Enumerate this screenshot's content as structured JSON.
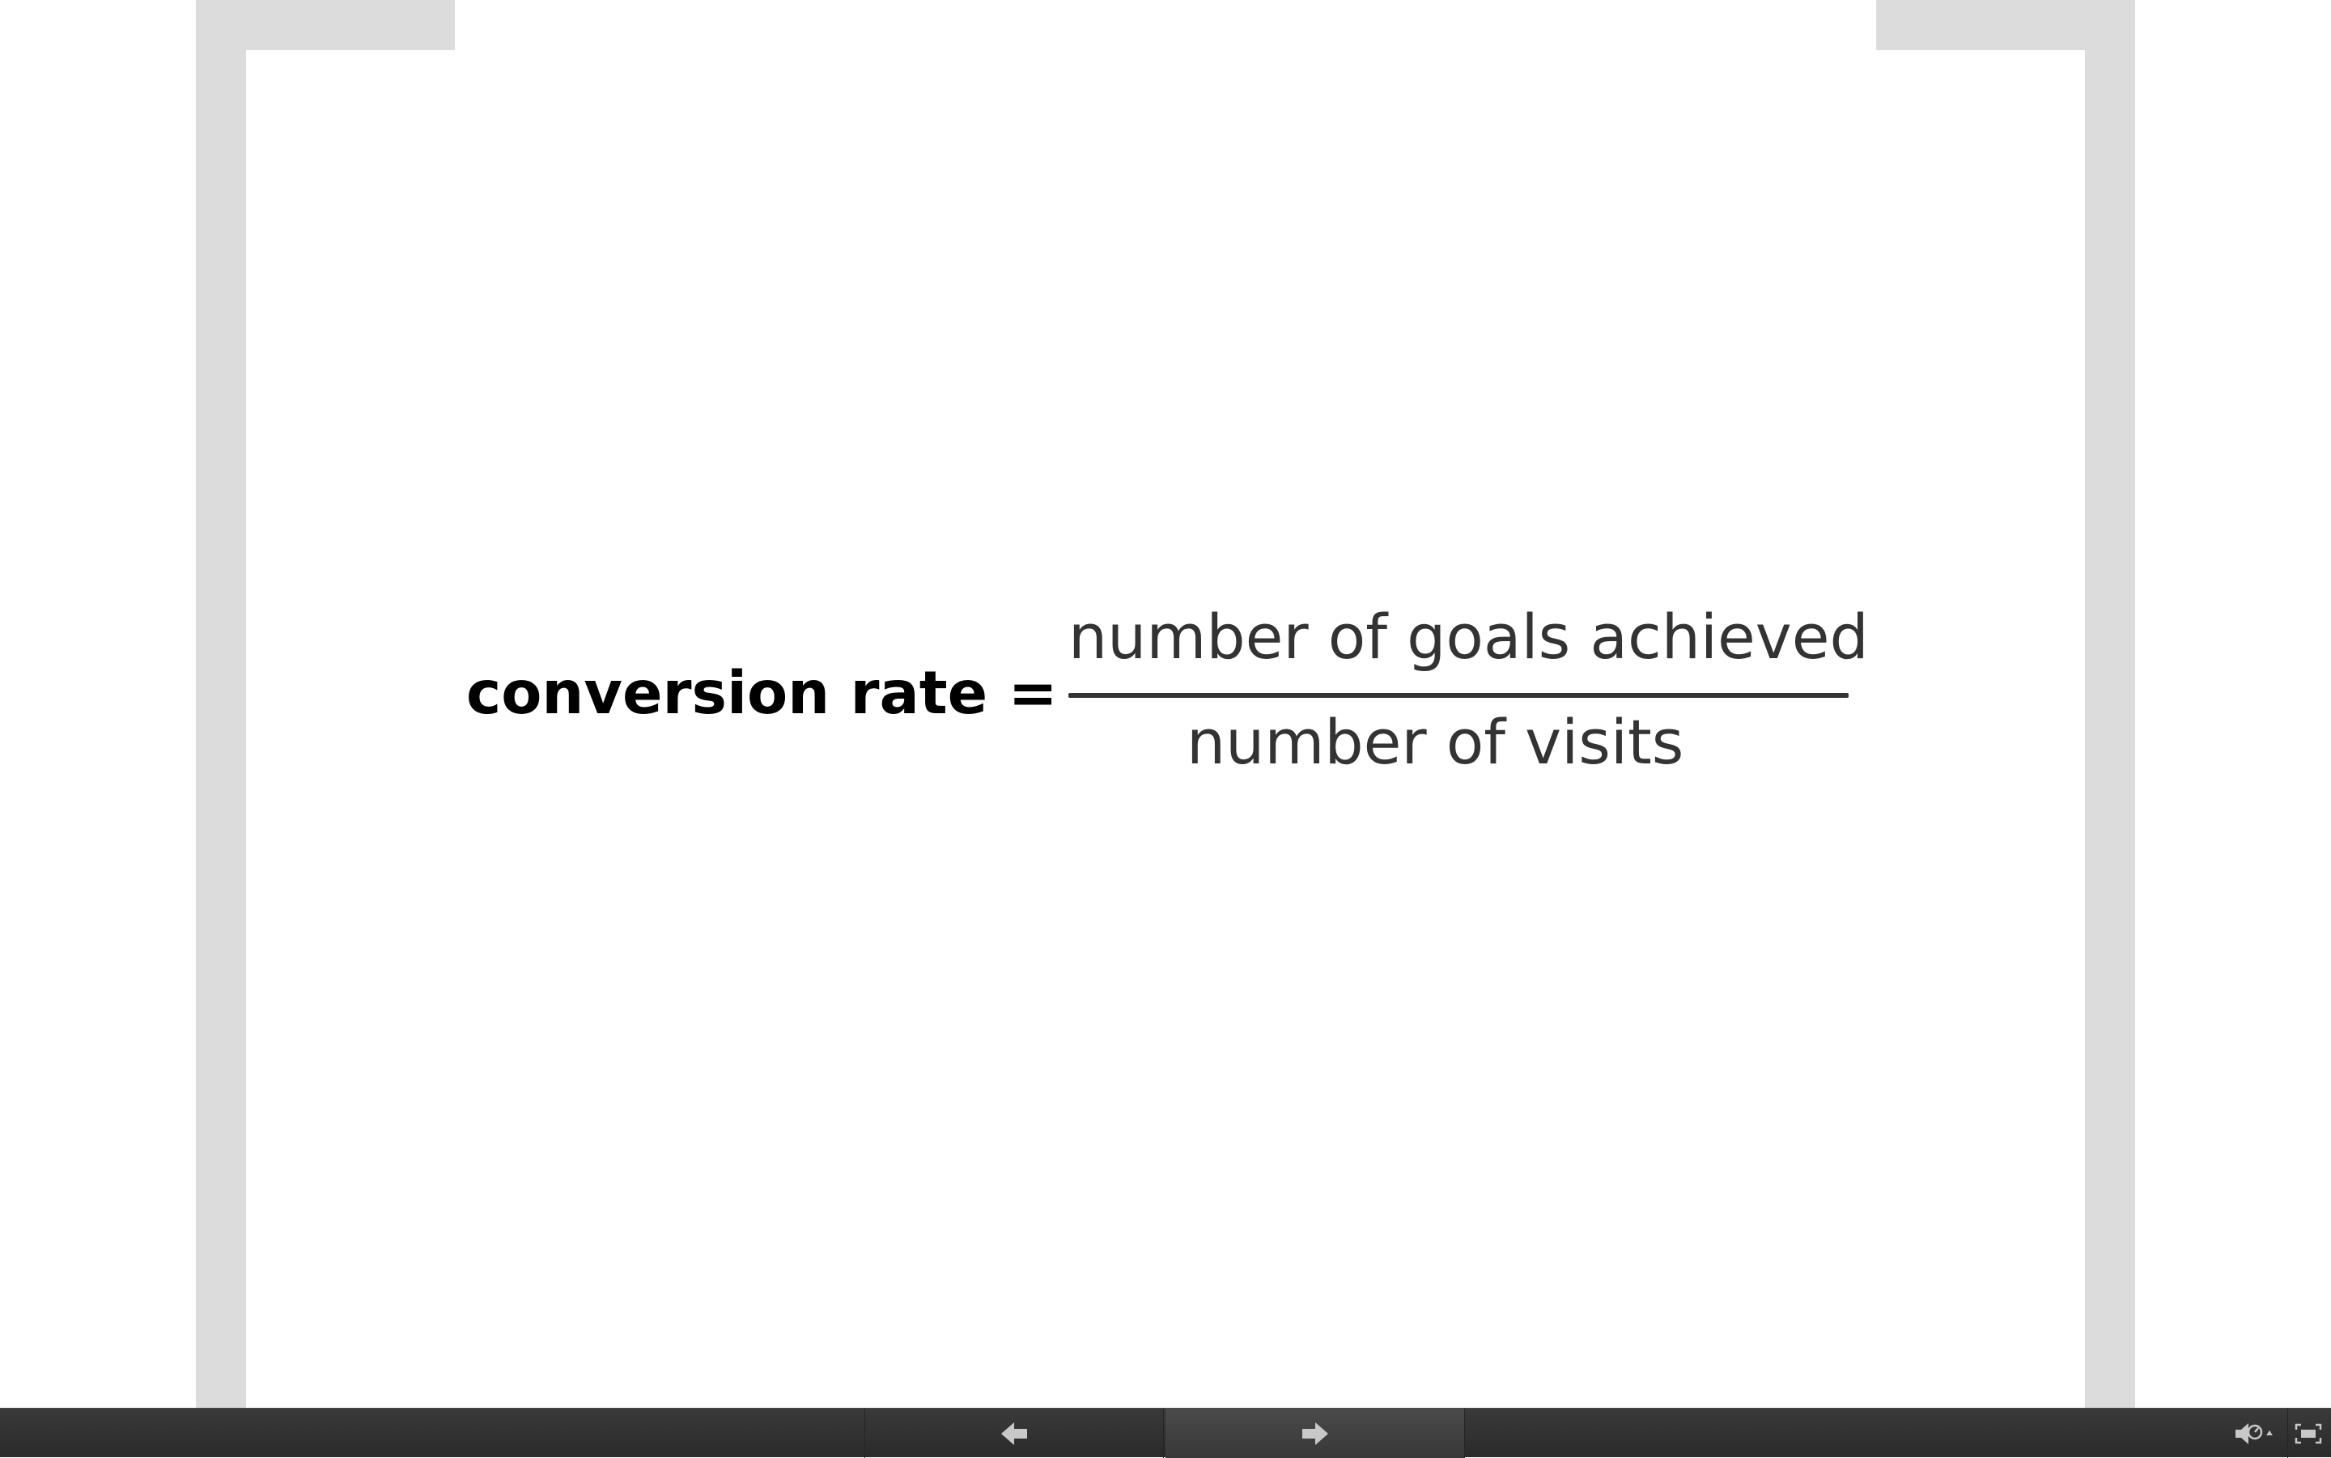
{
  "slide": {
    "formula": {
      "lhs": "conversion rate =",
      "numerator": "number of goals achieved",
      "denominator": "number of visits"
    }
  },
  "controls": {
    "prev_icon": "arrow-left-icon",
    "next_icon": "arrow-right-icon",
    "audio_icon": "audio-options-icon",
    "fullscreen_icon": "fullscreen-icon"
  },
  "colors": {
    "bracket": "#dcdcdc",
    "formula_text": "#333333",
    "controlbar": "#2f2f2f",
    "icon": "#c8c8c8"
  }
}
